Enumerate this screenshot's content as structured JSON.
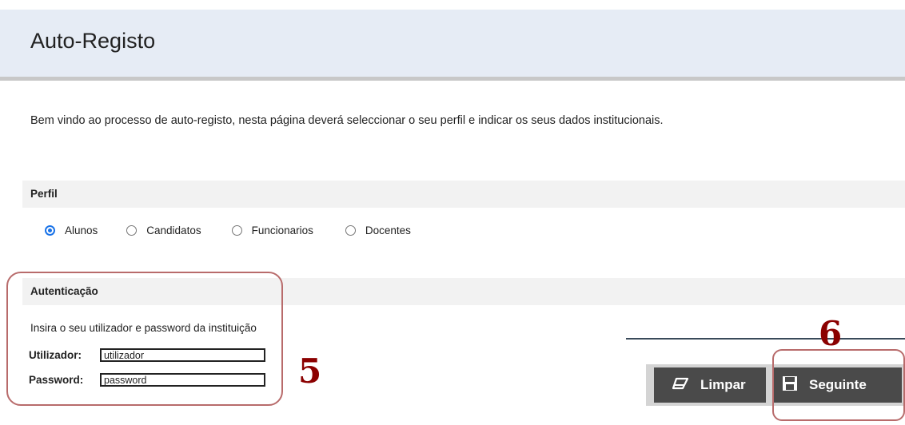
{
  "header": {
    "title": "Auto-Registo"
  },
  "intro": {
    "text": "Bem vindo ao processo de auto-registo, nesta página deverá seleccionar o seu perfil e indicar os seus dados institucionais."
  },
  "perfil": {
    "title": "Perfil",
    "options": [
      {
        "label": "Alunos",
        "checked": true
      },
      {
        "label": "Candidatos",
        "checked": false
      },
      {
        "label": "Funcionarios",
        "checked": false
      },
      {
        "label": "Docentes",
        "checked": false
      }
    ]
  },
  "auth": {
    "title": "Autenticação",
    "description": "Insira o seu utilizador e password da instituição",
    "user_label": "Utilizador:",
    "user_value": "utilizador",
    "password_label": "Password:",
    "password_value": "password"
  },
  "annotations": {
    "auth_marker": "5",
    "next_marker": "6",
    "outline_color": "#b86b6b",
    "marker_color": "#8b0000"
  },
  "toolbar": {
    "clear_label": "Limpar",
    "clear_icon": "eraser-icon",
    "next_label": "Seguinte",
    "next_icon": "save-icon"
  }
}
